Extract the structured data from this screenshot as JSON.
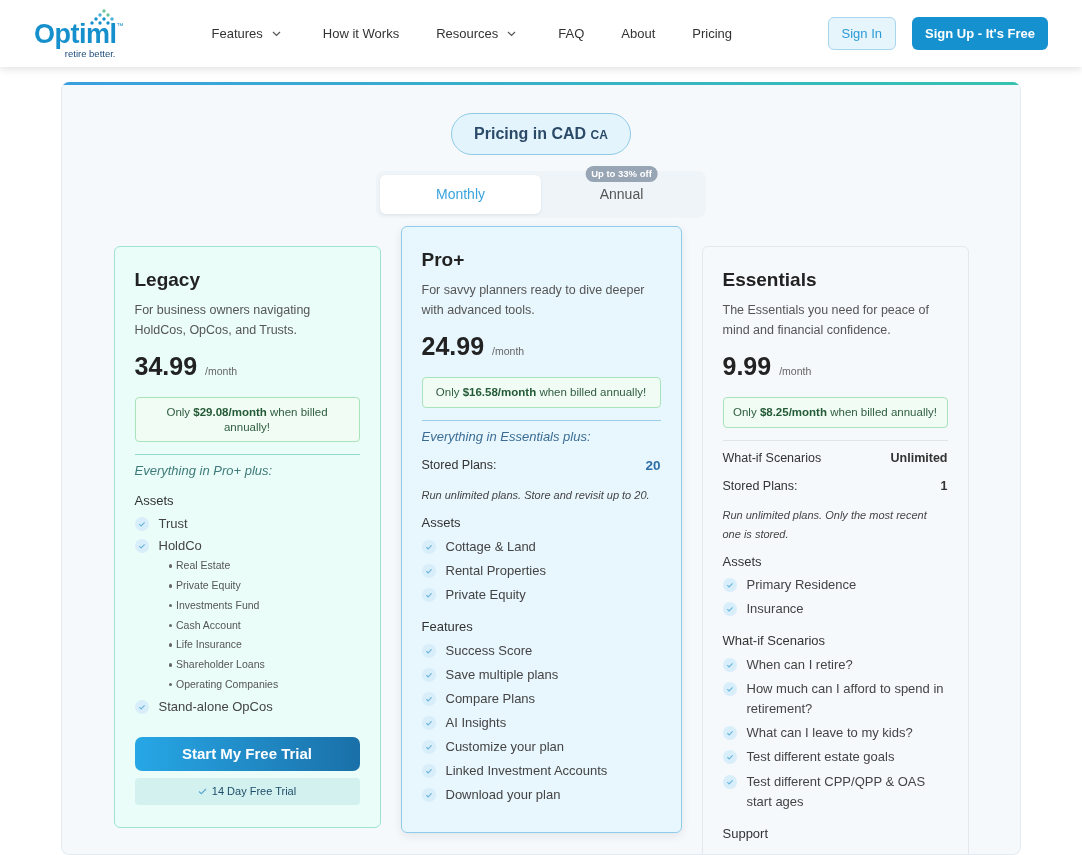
{
  "navbar": {
    "logo": {
      "wordmark": "Optiml",
      "trademark": "™",
      "tagline": "retire better."
    },
    "menu": [
      {
        "label": "Features",
        "dropdown": true
      },
      {
        "label": "How it Works",
        "dropdown": false
      },
      {
        "label": "Resources",
        "dropdown": true
      },
      {
        "label": "FAQ",
        "dropdown": false
      },
      {
        "label": "About",
        "dropdown": false
      },
      {
        "label": "Pricing",
        "dropdown": false
      }
    ],
    "sign_in": "Sign In",
    "sign_up": "Sign Up - It's Free"
  },
  "pricing": {
    "currency_label": "Pricing in CAD",
    "currency_code": "CA",
    "billing_tabs": [
      {
        "label": "Monthly",
        "selected": true
      },
      {
        "label": "Annual",
        "selected": false,
        "badge": "Up to 33% off"
      }
    ],
    "plans": [
      {
        "kind": "premium",
        "name": "Legacy",
        "description": "For business owners navigating HoldCos, OpCos, and Trusts.",
        "price": "34.99",
        "period": "/month",
        "annual_note": "Only **$29.08/month** when billed annually!",
        "intro": "Everything in Pro+ plus:",
        "sections": [
          {
            "title": "Assets",
            "items": [
              {
                "label": "Trust"
              },
              {
                "label": "HoldCo",
                "children": [
                  "Real Estate",
                  "Private Equity",
                  "Investments Fund",
                  "Cash Account",
                  "Life Insurance",
                  "Shareholder Loans",
                  "Operating Companies"
                ]
              },
              {
                "label": "Stand-alone OpCos"
              }
            ]
          }
        ],
        "cta": "Start My Free Trial",
        "trial_note": "14 Day Free Trial"
      },
      {
        "kind": "featured",
        "name": "Pro+",
        "description": "For savvy planners ready to dive deeper with advanced tools.",
        "price": "24.99",
        "period": "/month",
        "annual_note": "Only **$16.58/month** when billed annually!",
        "intro": "Everything in Essentials plus:",
        "stats": [
          {
            "label": "Stored Plans:",
            "value": "20"
          }
        ],
        "note": "Run unlimited plans. Store and revisit up to 20.",
        "sections": [
          {
            "title": "Assets",
            "items": [
              {
                "label": "Cottage & Land"
              },
              {
                "label": "Rental Properties"
              },
              {
                "label": "Private Equity"
              }
            ]
          },
          {
            "title": "Features",
            "items": [
              {
                "label": "Success Score"
              },
              {
                "label": "Save multiple plans"
              },
              {
                "label": "Compare Plans"
              },
              {
                "label": "AI Insights"
              },
              {
                "label": "Customize your plan"
              },
              {
                "label": "Linked Investment Accounts"
              },
              {
                "label": "Download your plan"
              }
            ]
          }
        ]
      },
      {
        "kind": "basic",
        "name": "Essentials",
        "description": "The Essentials you need for peace of mind and financial confidence.",
        "price": "9.99",
        "period": "/month",
        "annual_note": "Only **$8.25/month** when billed annually!",
        "stats": [
          {
            "label": "What-if Scenarios",
            "value": "Unlimited"
          },
          {
            "label": "Stored Plans:",
            "value": "1"
          }
        ],
        "note": "Run unlimited plans. Only the most recent one is stored.",
        "sections": [
          {
            "title": "Assets",
            "items": [
              {
                "label": "Primary Residence"
              },
              {
                "label": "Insurance"
              }
            ]
          },
          {
            "title": "What-if Scenarios",
            "items": [
              {
                "label": "When can I retire?"
              },
              {
                "label": "How much can I afford to spend in retirement?"
              },
              {
                "label": "What can I leave to my kids?"
              },
              {
                "label": "Test different estate goals"
              },
              {
                "label": "Test different CPP/QPP & OAS start ages"
              }
            ]
          },
          {
            "title": "Support"
          }
        ]
      }
    ]
  }
}
